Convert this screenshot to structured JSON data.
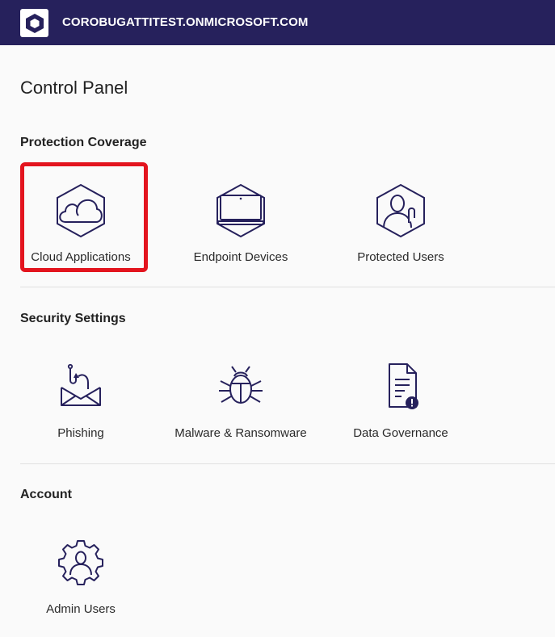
{
  "header": {
    "tenant_name": "COROBUGATTITEST.ONMICROSOFT.COM"
  },
  "page": {
    "title": "Control Panel"
  },
  "sections": [
    {
      "title": "Protection Coverage",
      "tiles": [
        {
          "label": "Cloud Applications",
          "icon": "cloud-hexagon-icon"
        },
        {
          "label": "Endpoint Devices",
          "icon": "laptop-hexagon-icon"
        },
        {
          "label": "Protected Users",
          "icon": "user-hexagon-icon"
        }
      ]
    },
    {
      "title": "Security Settings",
      "tiles": [
        {
          "label": "Phishing",
          "icon": "phishing-envelope-icon"
        },
        {
          "label": "Malware & Ransomware",
          "icon": "bug-icon"
        },
        {
          "label": "Data Governance",
          "icon": "document-alert-icon"
        }
      ]
    },
    {
      "title": "Account",
      "tiles": [
        {
          "label": "Admin Users",
          "icon": "user-gear-icon"
        }
      ]
    }
  ],
  "colors": {
    "header_bg": "#26215c",
    "icon_stroke": "#26215c",
    "highlight": "#e3141e"
  }
}
